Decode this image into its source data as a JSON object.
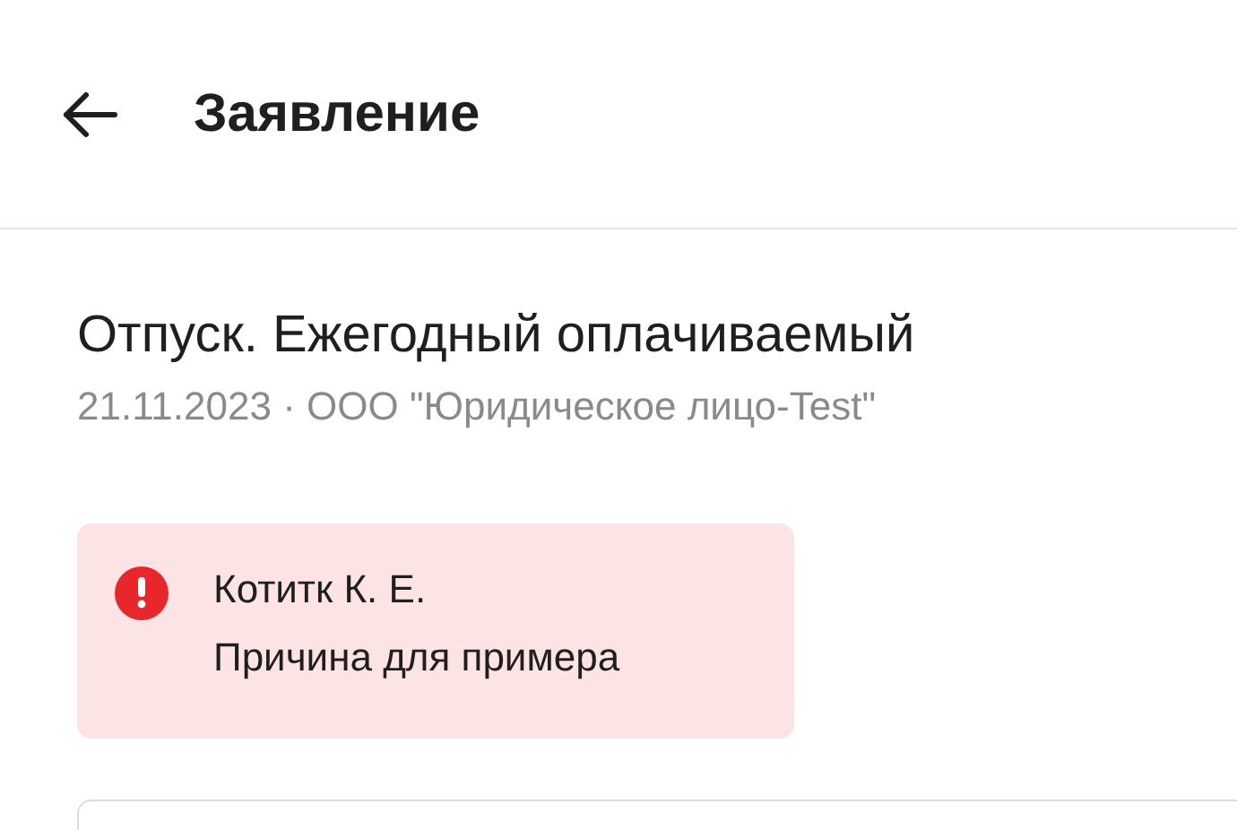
{
  "header": {
    "title": "Заявление"
  },
  "request": {
    "title": "Отпуск. Ежегодный оплачиваемый",
    "subtitle": "21.11.2023 · ООО \"Юридическое лицо-Test\""
  },
  "alert": {
    "kind": "error",
    "name": "Котитк К. Е.",
    "reason": "Причина для примера"
  }
}
